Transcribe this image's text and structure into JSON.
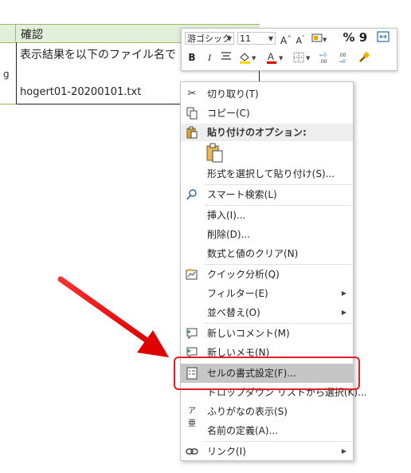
{
  "sheet": {
    "header_label": "確認",
    "left_fragment": "g",
    "cell_line1": "表示結果を以下のファイル名で",
    "cell_line2": "hogert01-20200101.txt"
  },
  "minibar": {
    "font_name": "游ゴシック",
    "font_size": "11",
    "bold": "B",
    "italic": "I",
    "percent": "%",
    "comma": "9"
  },
  "menu": {
    "cut": "切り取り(T)",
    "copy": "コピー(C)",
    "paste_options_header": "貼り付けのオプション:",
    "paste_special": "形式を選択して貼り付け(S)...",
    "smart_lookup": "スマート検索(L)",
    "insert": "挿入(I)...",
    "delete": "削除(D)...",
    "clear": "数式と値のクリア(N)",
    "quick_analysis": "クイック分析(Q)",
    "filter": "フィルター(E)",
    "sort": "並べ替え(O)",
    "new_comment": "新しいコメント(M)",
    "new_note": "新しいメモ(N)",
    "format_cells": "セルの書式設定(F)...",
    "dropdown_pick": "ドロップダウン リストから選択(K)...",
    "phonetic": "ふりがなの表示(S)",
    "define_name": "名前の定義(A)...",
    "link": "リンク(I)"
  },
  "colors": {
    "header_fill": "#e2efda",
    "highlight_red": "#e02020",
    "selected_row": "#c6c6c6"
  }
}
